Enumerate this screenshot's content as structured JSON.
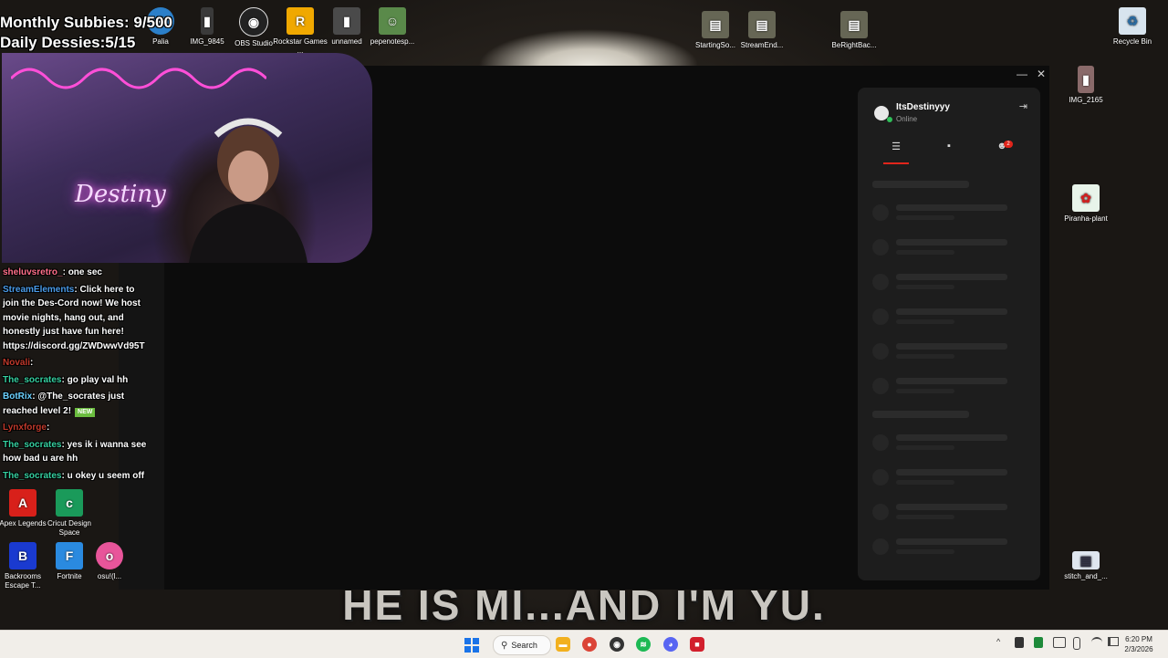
{
  "overlay": {
    "subs_line": "Monthly Subbies: 9/500",
    "dessies_line": "Daily Dessies:5/15",
    "cam_neon_text": "Destiny",
    "subtitle": "HE IS MI...AND I'M YU."
  },
  "desktop_icons": [
    {
      "label": "Palia",
      "color": "#2b7fc9",
      "glyph": "P"
    },
    {
      "label": "IMG_9845",
      "color": "#3a3a3a",
      "glyph": "▮"
    },
    {
      "label": "OBS Studio",
      "color": "#222222",
      "glyph": "◉"
    },
    {
      "label": "Rockstar Games ...",
      "color": "#f0a800",
      "glyph": "R"
    },
    {
      "label": "unnamed",
      "color": "#4a4a4a",
      "glyph": "▮"
    },
    {
      "label": "pepenotesp...",
      "color": "#5a8a4a",
      "glyph": "☺"
    },
    {
      "label": "StartingSo...",
      "color": "#666655",
      "glyph": "▤"
    },
    {
      "label": "StreamEnd...",
      "color": "#666655",
      "glyph": "▤"
    },
    {
      "label": "BeRightBac...",
      "color": "#666655",
      "glyph": "▤"
    },
    {
      "label": "Recycle Bin",
      "color": "#d8e4ee",
      "glyph": "♻"
    },
    {
      "label": "IMG_2165",
      "color": "#8a6a6a",
      "glyph": "▮"
    },
    {
      "label": "Piranha-plant",
      "color": "#e8f4ea",
      "glyph": "✿"
    },
    {
      "label": "stitch_and_...",
      "color": "#dfe6ef",
      "glyph": "▦"
    },
    {
      "label": "Apex Legends",
      "color": "#d8201a",
      "glyph": "A"
    },
    {
      "label": "Cricut Design Space",
      "color": "#1a9a5a",
      "glyph": "c"
    },
    {
      "label": "Backrooms Escape T...",
      "color": "#1a3ad0",
      "glyph": "B"
    },
    {
      "label": "Fortnite",
      "color": "#2a8ae0",
      "glyph": "F"
    },
    {
      "label": "osu!(l...",
      "color": "#e8559a",
      "glyph": "o"
    }
  ],
  "chat": [
    {
      "user": "sheluvsretro_",
      "user_color": "#ff6f8a",
      "text": ": one sec"
    },
    {
      "user": "StreamElements",
      "user_color": "#4a9be8",
      "text": ": Click here to join the Des-Cord now! We host movie nights, hang out, and honestly just have fun here! https://discord.gg/ZWDwwVd95T"
    },
    {
      "user": "Novali",
      "user_color": "#c0392b",
      "text": ":"
    },
    {
      "user": "The_socrates",
      "user_color": "#35d0a0",
      "text": ": go play val hh"
    },
    {
      "user": "BotRix",
      "user_color": "#6bd1ff",
      "text": ": @The_socrates just reached level 2!",
      "badge": "NEW"
    },
    {
      "user": "Lynxforge",
      "user_color": "#c0392b",
      "text": ":"
    },
    {
      "user": "The_socrates",
      "user_color": "#35d0a0",
      "text": ": yes ik i wanna see how bad u are hh"
    },
    {
      "user": "The_socrates",
      "user_color": "#35d0a0",
      "text": ": u okey u seem off"
    }
  ],
  "window": {
    "minimize_glyph": "—",
    "close_glyph": "✕"
  },
  "panel": {
    "username": "ItsDestinyyy",
    "status": "Online",
    "collapse_glyph": "⇥",
    "tabs": [
      {
        "name": "list-tab",
        "glyph": "☰"
      },
      {
        "name": "chat-tab",
        "glyph": "▪"
      },
      {
        "name": "friends-tab",
        "glyph": "☻"
      }
    ],
    "friends_badge": "2",
    "accent_color": "#e1251b",
    "online_color": "#2fbf59"
  },
  "taskbar": {
    "search_label": "Search",
    "apps": [
      {
        "name": "file-explorer",
        "color": "#f2b01e",
        "glyph": "▬"
      },
      {
        "name": "chrome",
        "color": "#db4437",
        "glyph": "●"
      },
      {
        "name": "obs",
        "color": "#333333",
        "glyph": "◉"
      },
      {
        "name": "spotify",
        "color": "#1db954",
        "glyph": "≋"
      },
      {
        "name": "discord",
        "color": "#5865f2",
        "glyph": "◕"
      },
      {
        "name": "streaming-app",
        "color": "#d21f2c",
        "glyph": "■"
      }
    ],
    "tray": {
      "chevron": "^",
      "time": "6:20 PM",
      "date": "2/3/2026"
    }
  }
}
